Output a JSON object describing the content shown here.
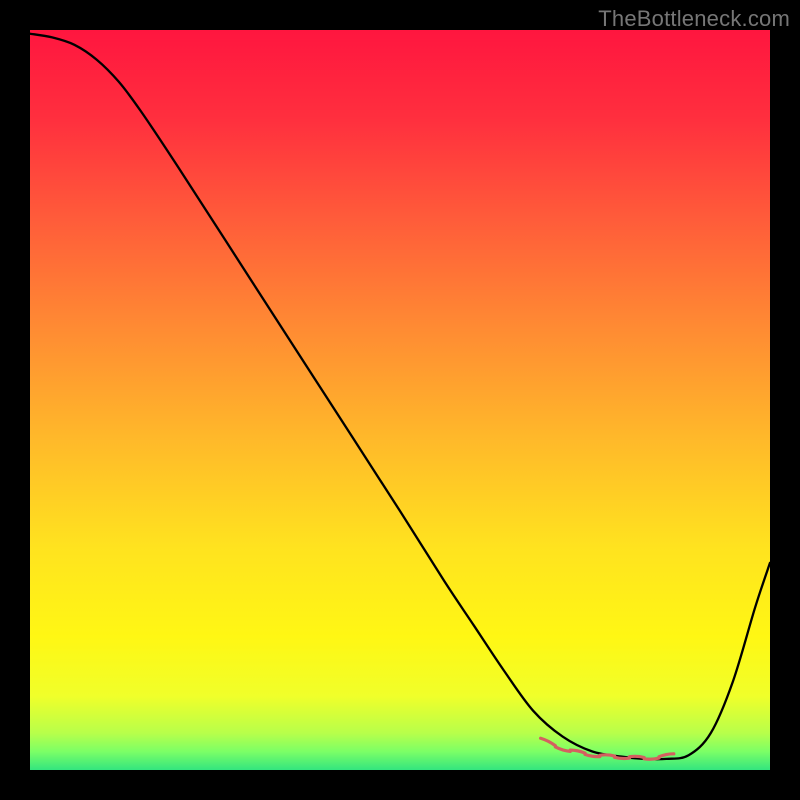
{
  "watermark": "TheBottleneck.com",
  "chart_data": {
    "type": "line",
    "title": "",
    "xlabel": "",
    "ylabel": "",
    "xlim": [
      0,
      100
    ],
    "ylim": [
      0,
      100
    ],
    "grid": false,
    "background_gradient": {
      "stops": [
        {
          "pos": 0.0,
          "color": "#ff163f"
        },
        {
          "pos": 0.12,
          "color": "#ff2f3e"
        },
        {
          "pos": 0.25,
          "color": "#ff5a3a"
        },
        {
          "pos": 0.4,
          "color": "#ff8a33"
        },
        {
          "pos": 0.55,
          "color": "#ffb82a"
        },
        {
          "pos": 0.7,
          "color": "#ffe31f"
        },
        {
          "pos": 0.82,
          "color": "#fff714"
        },
        {
          "pos": 0.9,
          "color": "#f0ff2a"
        },
        {
          "pos": 0.95,
          "color": "#b8ff4a"
        },
        {
          "pos": 0.975,
          "color": "#7cff66"
        },
        {
          "pos": 1.0,
          "color": "#33e57f"
        }
      ]
    },
    "series": [
      {
        "name": "bottleneck-curve",
        "color": "#000000",
        "width": 2.3,
        "x": [
          0.0,
          3.0,
          6.0,
          9.0,
          12.0,
          15.0,
          20.0,
          30.0,
          40.0,
          50.0,
          56.0,
          60.0,
          64.0,
          68.0,
          72.0,
          76.0,
          80.0,
          83.0,
          86.0,
          89.0,
          92.0,
          95.0,
          98.0,
          100.0
        ],
        "y": [
          99.5,
          99.0,
          98.0,
          96.0,
          93.0,
          89.0,
          81.5,
          66.0,
          50.5,
          35.0,
          25.5,
          19.5,
          13.5,
          8.0,
          4.5,
          2.5,
          1.8,
          1.5,
          1.5,
          2.0,
          5.0,
          12.0,
          22.0,
          28.0
        ]
      },
      {
        "name": "optimal-band-marker",
        "color": "#d46060",
        "width": 3.2,
        "style": "dashed-wiggle",
        "x": [
          69.0,
          71.0,
          73.0,
          75.0,
          77.0,
          79.0,
          81.0,
          83.0,
          85.0,
          87.0
        ],
        "y": [
          4.2,
          3.2,
          2.6,
          2.2,
          1.9,
          1.8,
          1.7,
          1.6,
          1.7,
          2.1
        ]
      }
    ]
  }
}
